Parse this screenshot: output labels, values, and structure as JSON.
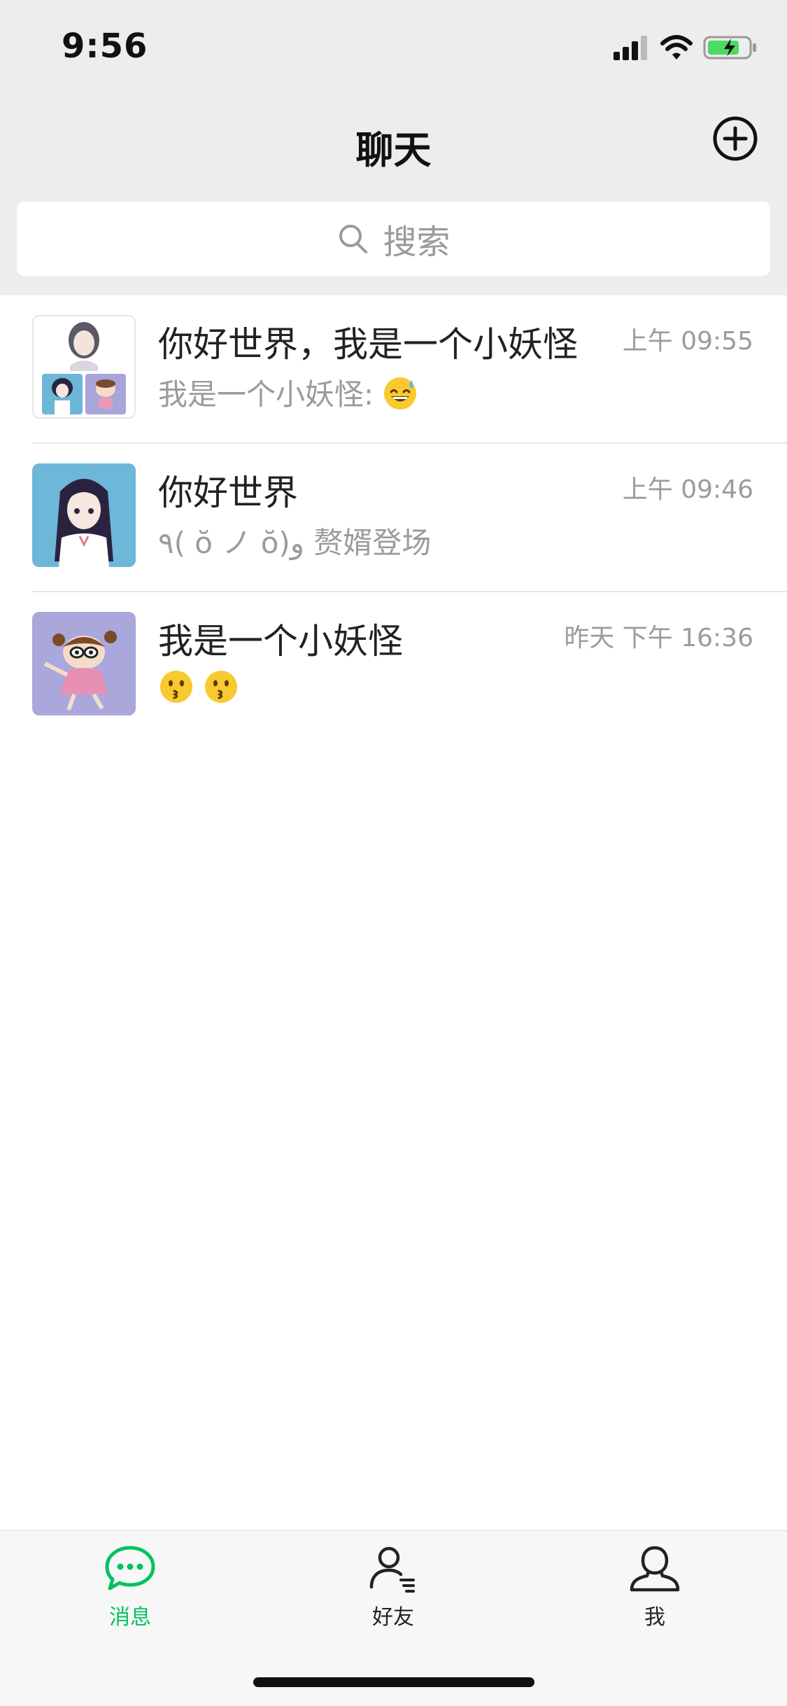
{
  "status_bar": {
    "time": "9:56"
  },
  "nav": {
    "title": "聊天",
    "add_icon": "plus-circle-icon"
  },
  "search": {
    "placeholder": "搜索",
    "icon": "search-icon"
  },
  "chats": [
    {
      "name": "你好世界，我是一个小妖怪",
      "time": "上午 09:55",
      "preview": "我是一个小妖怪:",
      "preview_emojis": [
        "sweat-smile-emoji"
      ]
    },
    {
      "name": "你好世界",
      "time": "上午 09:46",
      "preview": "٩( ŏ ノ ŏ)و 赘婿登场",
      "preview_emojis": []
    },
    {
      "name": "我是一个小妖怪",
      "time": "昨天 下午 16:36",
      "preview": "",
      "preview_emojis": [
        "kissing-face-emoji",
        "kissing-face-emoji"
      ]
    }
  ],
  "tabs": [
    {
      "label": "消息",
      "icon": "chat-bubble-icon",
      "active": true
    },
    {
      "label": "好友",
      "icon": "friends-icon",
      "active": false
    },
    {
      "label": "我",
      "icon": "profile-icon",
      "active": false
    }
  ],
  "colors": {
    "accent": "#07c160",
    "header_bg": "#ededed",
    "secondary_text": "#9b9b9b"
  }
}
